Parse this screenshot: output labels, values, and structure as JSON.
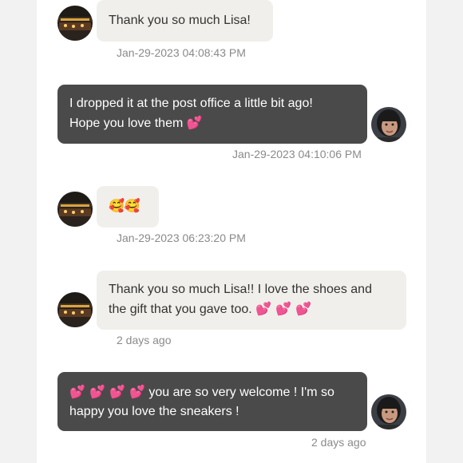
{
  "colors": {
    "incoming_bubble": "#f1efeb",
    "outgoing_bubble": "#4a4a4a",
    "timestamp": "#8a8a8a",
    "heart_emoji": "#ff4fa3"
  },
  "messages": [
    {
      "direction": "incoming",
      "avatar_icon": "storefront-night-avatar",
      "text": "Thank you so much Lisa!",
      "timestamp": "Jan-29-2023 04:08:43 PM"
    },
    {
      "direction": "outgoing",
      "avatar_icon": "woman-portrait-avatar",
      "line1": "I dropped it at the post office a little bit ago!",
      "line2": "Hope you love them",
      "emoji": "💕",
      "timestamp": "Jan-29-2023 04:10:06 PM"
    },
    {
      "direction": "incoming",
      "avatar_icon": "storefront-night-avatar",
      "emoji": "🥰🥰",
      "timestamp": "Jan-29-2023 06:23:20 PM"
    },
    {
      "direction": "incoming",
      "avatar_icon": "storefront-night-avatar",
      "line1": "Thank you so much Lisa!! I love the shoes and",
      "line2": "the gift that you gave too.",
      "emoji": "💕 💕 💕",
      "timestamp": "2 days ago"
    },
    {
      "direction": "outgoing",
      "avatar_icon": "woman-portrait-avatar",
      "emoji": "💕 💕 💕 💕",
      "line1": "you are so very welcome ! I'm so",
      "line2": "happy you love the sneakers !",
      "timestamp": "2 days ago"
    }
  ]
}
